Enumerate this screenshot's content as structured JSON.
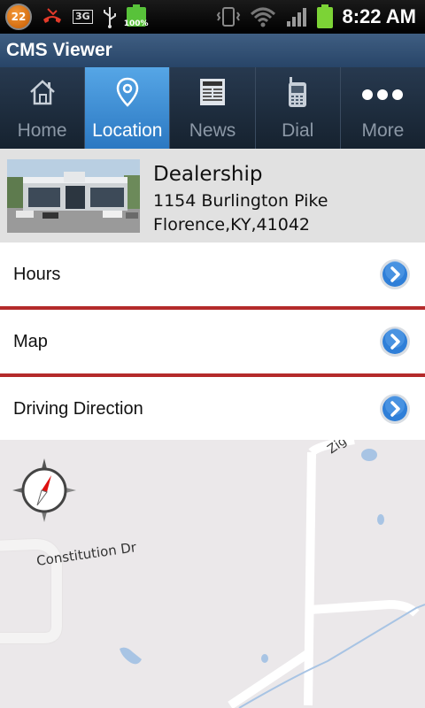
{
  "status_bar": {
    "notification_count": "22",
    "network": "3G",
    "battery_small_label": "100%",
    "time": "8:22 AM"
  },
  "app": {
    "title": "CMS Viewer"
  },
  "tabs": [
    {
      "label": "Home",
      "icon": "home-icon",
      "active": false
    },
    {
      "label": "Location",
      "icon": "location-pin-icon",
      "active": true
    },
    {
      "label": "News",
      "icon": "newspaper-icon",
      "active": false
    },
    {
      "label": "Dial",
      "icon": "phone-icon",
      "active": false
    },
    {
      "label": "More",
      "icon": "more-dots-icon",
      "active": false
    }
  ],
  "dealer": {
    "name": "Dealership",
    "address_line1": "1154 Burlington Pike",
    "address_line2": "Florence,KY,41042"
  },
  "rows": [
    {
      "label": "Hours"
    },
    {
      "label": "Map"
    },
    {
      "label": "Driving Direction"
    }
  ],
  "map": {
    "street_label_1": "Constitution Dr",
    "street_label_2": "Zig"
  },
  "colors": {
    "title_bar": "#284568",
    "tab_active": "#2b78c2",
    "divider": "#b42a2a",
    "chevron": "#2f7fd8",
    "map_bg": "#ebe8ea",
    "water": "#a8c4e4"
  }
}
